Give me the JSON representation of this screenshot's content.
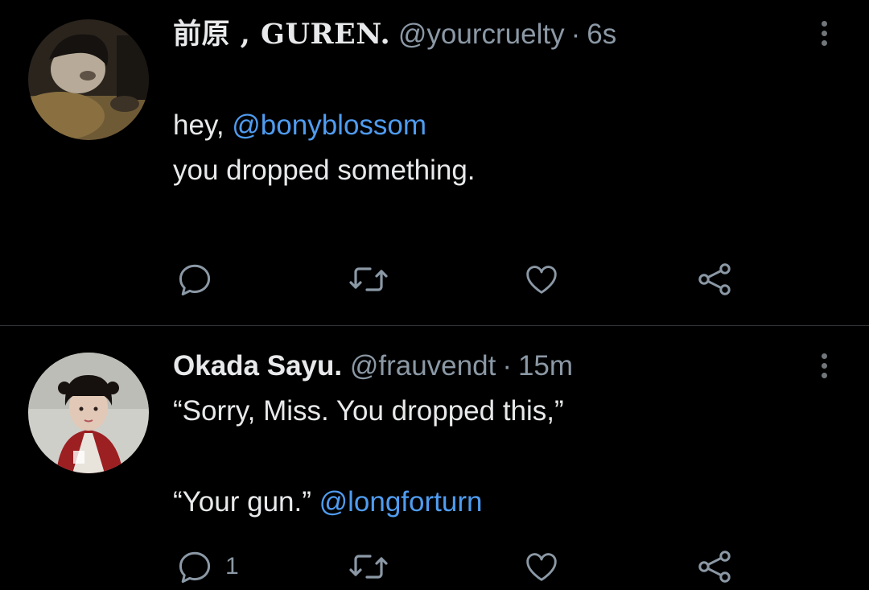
{
  "colors": {
    "background": "#000000",
    "text": "#e7e9ea",
    "secondary": "#8b98a5",
    "mention": "#4f9cf0",
    "divider": "#2f3336"
  },
  "tweets": [
    {
      "display_name": "前原 , GUREN.",
      "handle": "@yourcruelty",
      "separator": "·",
      "time": "6s",
      "lines": [
        {
          "pre": "hey, ",
          "mention": "@bonyblossom"
        },
        {
          "pre": "you dropped something."
        }
      ],
      "actions": {
        "reply": "reply-icon",
        "retweet": "retweet-icon",
        "like": "heart-icon",
        "share": "share-icon"
      }
    },
    {
      "display_name": "Okada Sayu.",
      "handle": "@frauvendt",
      "separator": "·",
      "time": "15m",
      "lines": [
        {
          "pre": "“Sorry, Miss. You dropped this,”"
        },
        {
          "pre": "“Your gun.” ",
          "mention": "@longforturn"
        }
      ],
      "reply_count": "1",
      "actions": {
        "reply": "reply-icon",
        "retweet": "retweet-icon",
        "like": "heart-icon",
        "share": "share-icon"
      }
    }
  ]
}
